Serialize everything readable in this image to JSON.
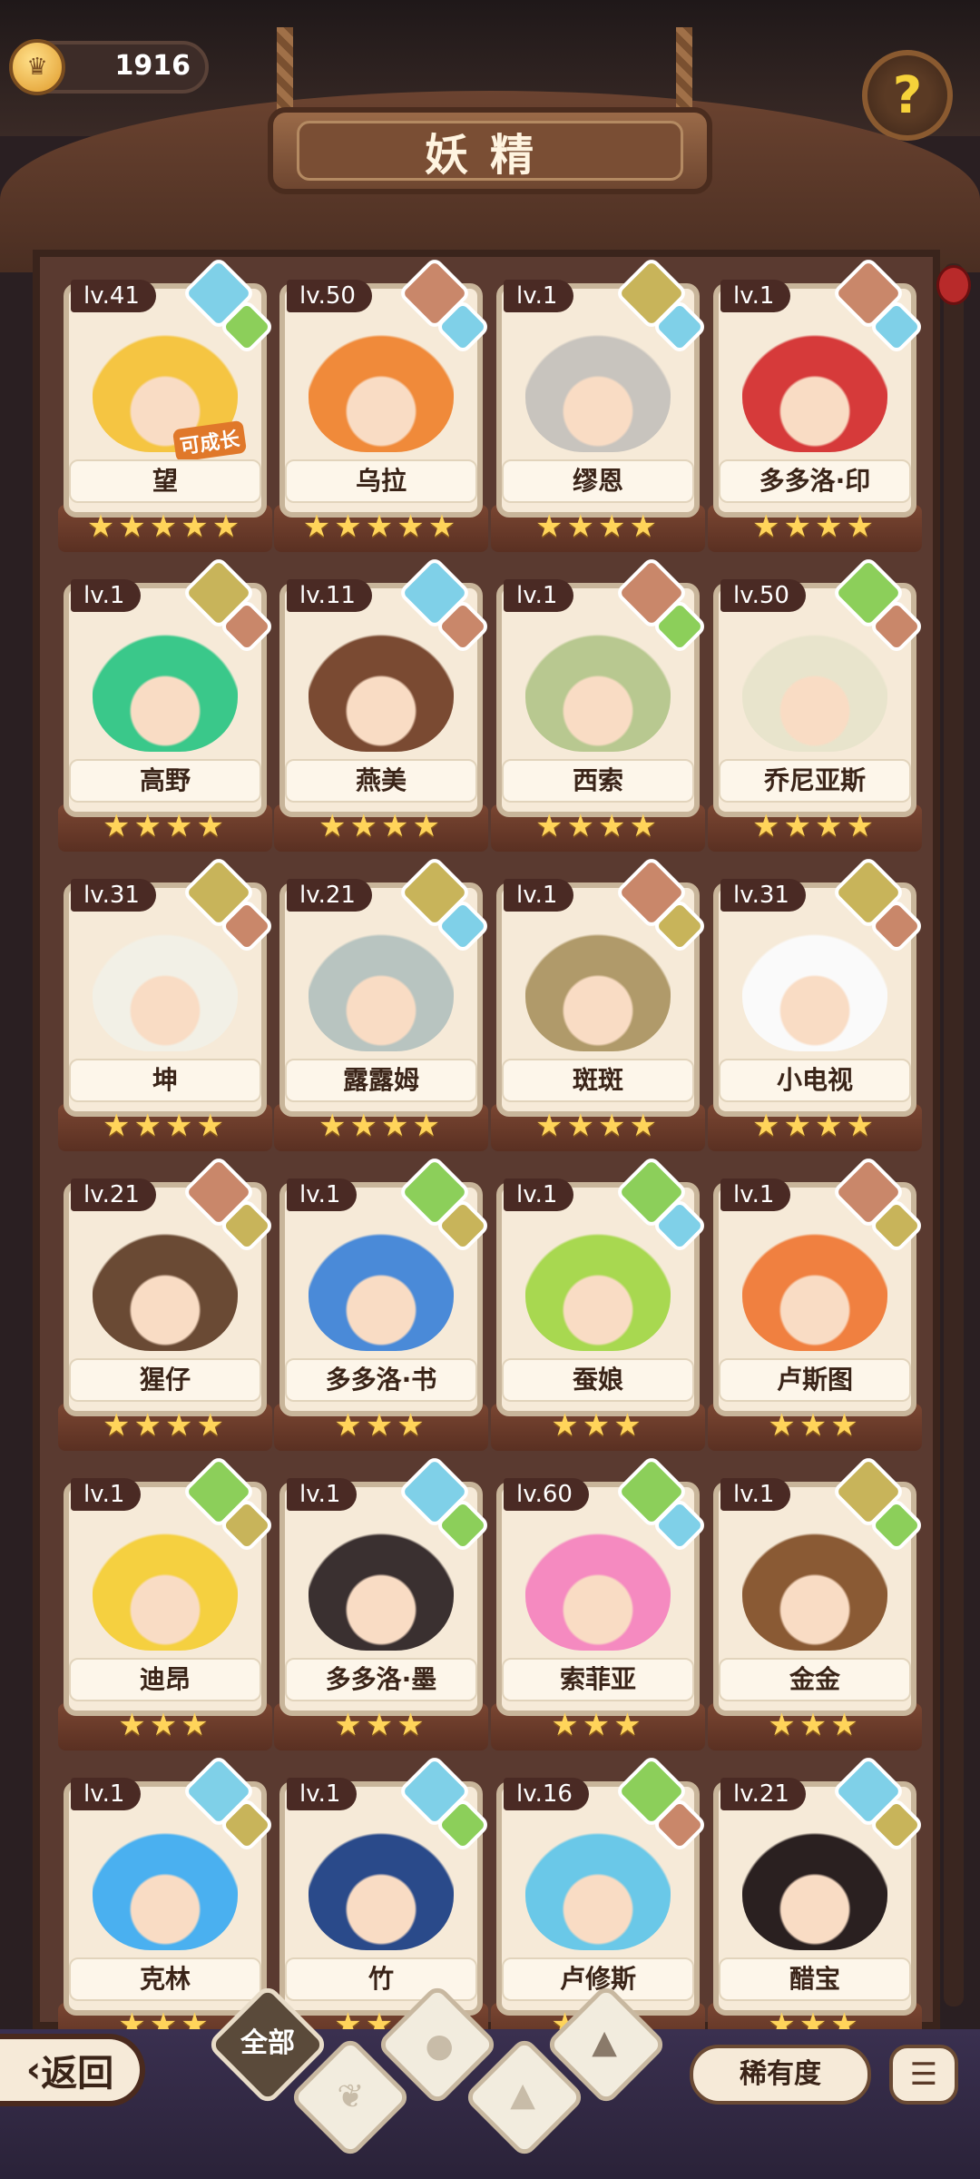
{
  "header": {
    "coins": "1916",
    "title": "妖精",
    "help_icon": "question-leaf-icon"
  },
  "footer": {
    "back_label": "返回",
    "filters": [
      {
        "label": "全部",
        "icon": "all-icon"
      },
      {
        "label": "",
        "icon": "sprout-icon"
      },
      {
        "label": "",
        "icon": "water-drop-icon"
      },
      {
        "label": "",
        "icon": "earth-icon"
      },
      {
        "label": "",
        "icon": "mountain-icon"
      }
    ],
    "rarity_label": "稀有度",
    "sort_icon": "sort-list-icon"
  },
  "colors": {
    "water": "#7fd0e8",
    "plant": "#8ccf5a",
    "earth": "#c8b45a",
    "mountain": "#c9876a",
    "star": "#ffd45a"
  },
  "fairies": [
    {
      "name": "望",
      "level": "lv.41",
      "stars": 5,
      "elements": [
        "water",
        "plant"
      ],
      "badge": "可成长",
      "color": "#f5c542"
    },
    {
      "name": "乌拉",
      "level": "lv.50",
      "stars": 5,
      "elements": [
        "mountain",
        "water"
      ],
      "color": "#f08a3a"
    },
    {
      "name": "缪恩",
      "level": "lv.1",
      "stars": 4,
      "elements": [
        "earth",
        "water"
      ],
      "color": "#c8c4be"
    },
    {
      "name": "多多洛·印",
      "level": "lv.1",
      "stars": 4,
      "elements": [
        "mountain",
        "water"
      ],
      "color": "#d63a3a"
    },
    {
      "name": "高野",
      "level": "lv.1",
      "stars": 4,
      "elements": [
        "earth",
        "mountain"
      ],
      "color": "#3ac88a"
    },
    {
      "name": "燕美",
      "level": "lv.11",
      "stars": 4,
      "elements": [
        "water",
        "mountain"
      ],
      "color": "#7a4a32"
    },
    {
      "name": "西索",
      "level": "lv.1",
      "stars": 4,
      "elements": [
        "mountain",
        "plant"
      ],
      "color": "#b8c890"
    },
    {
      "name": "乔尼亚斯",
      "level": "lv.50",
      "stars": 4,
      "elements": [
        "plant",
        "mountain"
      ],
      "color": "#e8e4cc"
    },
    {
      "name": "坤",
      "level": "lv.31",
      "stars": 4,
      "elements": [
        "earth",
        "mountain"
      ],
      "color": "#f2f0e6"
    },
    {
      "name": "露露姆",
      "level": "lv.21",
      "stars": 4,
      "elements": [
        "earth",
        "water"
      ],
      "color": "#b8c4c0"
    },
    {
      "name": "斑斑",
      "level": "lv.1",
      "stars": 4,
      "elements": [
        "mountain",
        "earth"
      ],
      "color": "#b09a6a"
    },
    {
      "name": "小电视",
      "level": "lv.31",
      "stars": 4,
      "elements": [
        "earth",
        "mountain"
      ],
      "color": "#fafafa"
    },
    {
      "name": "猩仔",
      "level": "lv.21",
      "stars": 4,
      "elements": [
        "mountain",
        "earth"
      ],
      "color": "#6a4a34"
    },
    {
      "name": "多多洛·书",
      "level": "lv.1",
      "stars": 3,
      "elements": [
        "plant",
        "earth"
      ],
      "color": "#4a8ad8"
    },
    {
      "name": "蚕娘",
      "level": "lv.1",
      "stars": 3,
      "elements": [
        "plant",
        "water"
      ],
      "color": "#a8d850"
    },
    {
      "name": "卢斯图",
      "level": "lv.1",
      "stars": 3,
      "elements": [
        "mountain",
        "earth"
      ],
      "color": "#f08040"
    },
    {
      "name": "迪昂",
      "level": "lv.1",
      "stars": 3,
      "elements": [
        "plant",
        "earth"
      ],
      "color": "#f5d040"
    },
    {
      "name": "多多洛·墨",
      "level": "lv.1",
      "stars": 3,
      "elements": [
        "water",
        "plant"
      ],
      "color": "#3a3030"
    },
    {
      "name": "索菲亚",
      "level": "lv.60",
      "stars": 3,
      "elements": [
        "plant",
        "water"
      ],
      "color": "#f58ac0"
    },
    {
      "name": "金金",
      "level": "lv.1",
      "stars": 3,
      "elements": [
        "earth",
        "plant"
      ],
      "color": "#8a5a34"
    },
    {
      "name": "克林",
      "level": "lv.1",
      "stars": 3,
      "elements": [
        "water",
        "earth"
      ],
      "color": "#4ab0f0"
    },
    {
      "name": "竹",
      "level": "lv.1",
      "stars": 3,
      "elements": [
        "water",
        "plant"
      ],
      "color": "#2a4a8a"
    },
    {
      "name": "卢修斯",
      "level": "lv.16",
      "stars": 3,
      "elements": [
        "plant",
        "mountain"
      ],
      "color": "#6ac8e8"
    },
    {
      "name": "醋宝",
      "level": "lv.21",
      "stars": 3,
      "elements": [
        "water",
        "earth"
      ],
      "color": "#2a2020"
    }
  ]
}
